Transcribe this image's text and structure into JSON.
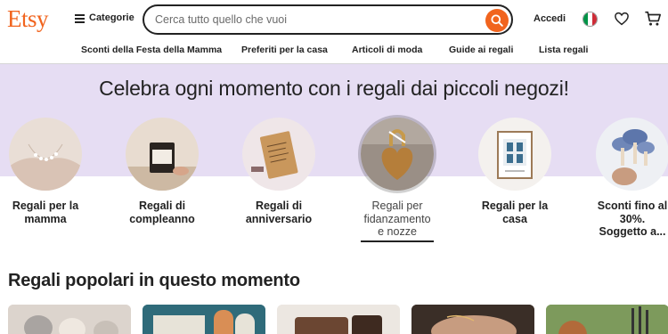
{
  "header": {
    "logo": "Etsy",
    "categories_label": "Categorie",
    "search_placeholder": "Cerca tutto quello che vuoi",
    "signin_label": "Accedi",
    "flag_colors": [
      "#009246",
      "#ffffff",
      "#CE2B37"
    ],
    "icons": [
      "menu-icon",
      "search-icon",
      "italy-flag-icon",
      "heart-icon",
      "cart-icon"
    ]
  },
  "nav": {
    "items": [
      "Sconti della Festa della Mamma",
      "Preferiti per la casa",
      "Articoli di moda",
      "Guide ai regali",
      "Lista regali"
    ]
  },
  "hero": {
    "title": "Celebra ogni momento con i regali dai piccoli negozi!",
    "background": "#E6DDF3",
    "categories": [
      {
        "line1": "Regali per la",
        "line2": "mamma",
        "line3": ""
      },
      {
        "line1": "Regali di",
        "line2": "compleanno",
        "line3": ""
      },
      {
        "line1": "Regali di",
        "line2": "anniversario",
        "line3": ""
      },
      {
        "line1": "Regali per",
        "line2": "fidanzamento",
        "line3": "e nozze"
      },
      {
        "line1": "Regali per la",
        "line2": "casa",
        "line3": ""
      },
      {
        "line1": "Sconti fino al",
        "line2": "30%.",
        "line3": "Soggetto a..."
      }
    ],
    "selected_index": 3
  },
  "popular": {
    "title": "Regali popolari in questo momento"
  },
  "colors": {
    "brand": "#F1641E",
    "text": "#222222"
  }
}
